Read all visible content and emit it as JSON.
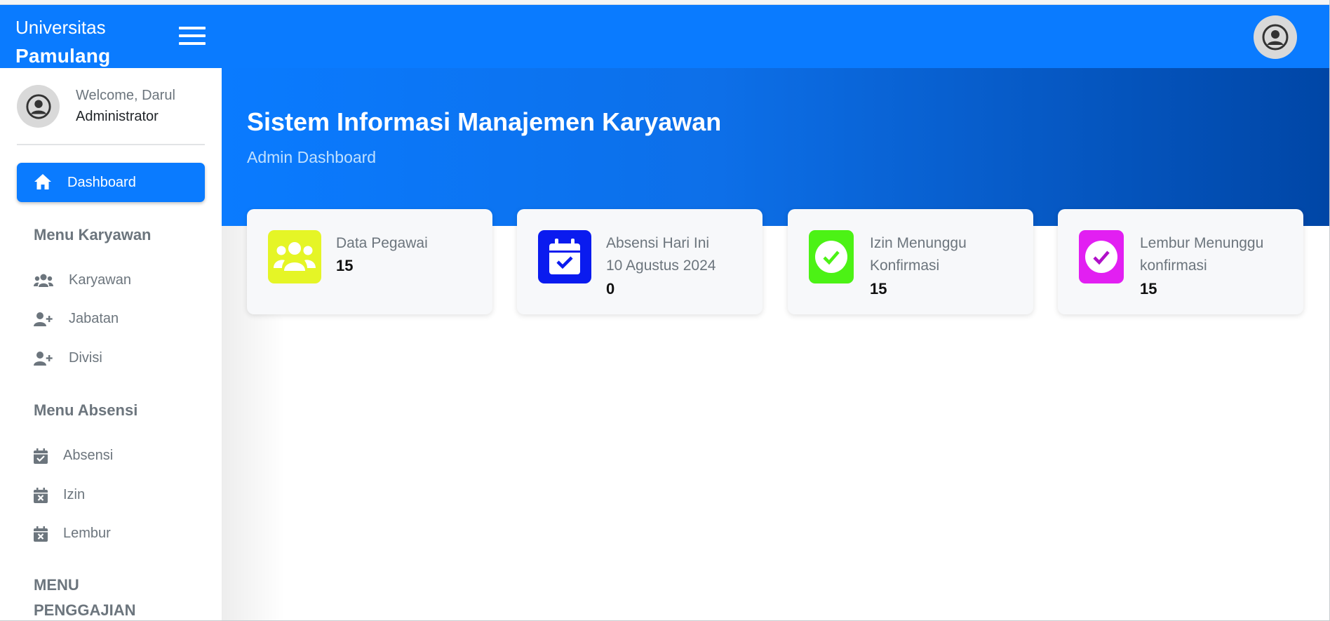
{
  "brand": {
    "line1": "Universitas",
    "line2": "Pamulang"
  },
  "user": {
    "welcome": "Welcome, Darul",
    "role": "Administrator"
  },
  "sidebar": {
    "active": {
      "label": "Dashboard",
      "icon": "home-icon"
    },
    "sections": [
      {
        "title": "Menu Karyawan",
        "items": [
          {
            "label": "Karyawan",
            "icon": "users-icon"
          },
          {
            "label": "Jabatan",
            "icon": "user-plus-icon"
          },
          {
            "label": "Divisi",
            "icon": "user-plus-icon"
          }
        ]
      },
      {
        "title": "Menu Absensi",
        "items": [
          {
            "label": "Absensi",
            "icon": "calendar-check-icon"
          },
          {
            "label": "Izin",
            "icon": "calendar-x-icon"
          },
          {
            "label": "Lembur",
            "icon": "calendar-x-icon"
          }
        ]
      },
      {
        "title_line1": "MENU",
        "title_line2": "PENGGAJIAN"
      }
    ]
  },
  "hero": {
    "title": "Sistem Informasi Manajemen Karyawan",
    "subtitle": "Admin Dashboard"
  },
  "cards": [
    {
      "label": "Data Pegawai",
      "value": "15",
      "icon": "users-icon",
      "color": "#e5f526"
    },
    {
      "label_line1": "Absensi Hari Ini",
      "label_line2": "10 Agustus 2024",
      "value": "0",
      "icon": "calendar-check-icon",
      "color": "#0a1bef"
    },
    {
      "label_line1": "Izin Menunggu",
      "label_line2": "Konfirmasi",
      "value": "15",
      "icon": "check-circle-icon",
      "color": "#4cf215"
    },
    {
      "label_line1": "Lembur Menunggu",
      "label_line2": "konfirmasi",
      "value": "15",
      "icon": "check-circle-icon",
      "color": "#e21ff2"
    }
  ],
  "colors": {
    "primary": "#0a7bff",
    "hero_dark": "#0046a6",
    "muted_text": "#6c757d"
  }
}
